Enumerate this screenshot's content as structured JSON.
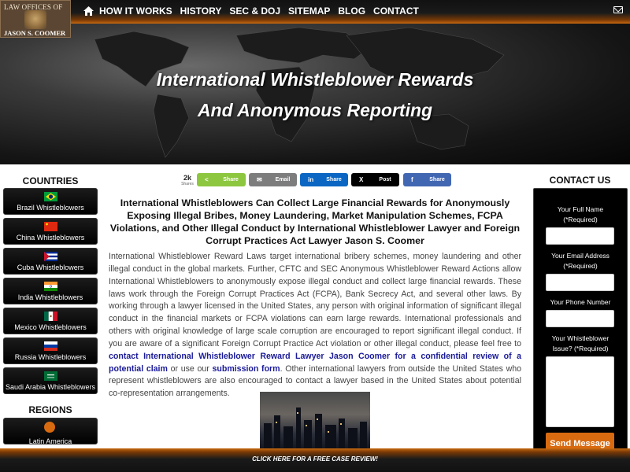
{
  "logo": {
    "line1": "LAW OFFICES OF",
    "line2": "JASON S. COOMER"
  },
  "nav": {
    "items": [
      "HOW IT WORKS",
      "HISTORY",
      "SEC & DOJ",
      "SITEMAP",
      "BLOG",
      "CONTACT"
    ]
  },
  "hero": {
    "line1": "International Whistleblower Rewards",
    "line2": "And Anonymous Reporting"
  },
  "left": {
    "countries_title": "COUNTRIES",
    "countries": [
      "Brazil Whistleblowers",
      "China Whistleblowers",
      "Cuba Whistleblowers",
      "India Whistleblowers",
      "Mexico Whistleblowers",
      "Russia Whistleblowers",
      "Saudi Arabia Whistleblowers"
    ],
    "regions_title": "REGIONS",
    "regions": [
      "Latin America"
    ]
  },
  "share": {
    "count": "2k",
    "count_label": "Shares",
    "buttons": [
      {
        "label": "Share",
        "color": "#8dc63f"
      },
      {
        "label": "Email",
        "color": "#7d7d7d"
      },
      {
        "label": "Share",
        "color": "#0a66c2"
      },
      {
        "label": "Post",
        "color": "#000000"
      },
      {
        "label": "Share",
        "color": "#4267b2"
      }
    ]
  },
  "main": {
    "title": "International Whistleblowers Can Collect Large Financial Rewards for Anonymously Exposing Illegal Bribes, Money Laundering, Market Manipulation Schemes, FCPA Violations, and Other Illegal Conduct by International Whistleblower Lawyer and Foreign Corrupt Practices Act Lawyer Jason S. Coomer",
    "body_1": "International Whistleblower Reward Laws target international bribery schemes, money laundering and other illegal conduct in the global markets. Further, CFTC and SEC Anonymous Whistleblower Reward Actions allow International Whistleblowers to anonymously expose illegal conduct and collect large financial rewards. These laws work through the Foreign Corrupt Practices Act (FCPA), Bank Secrecy Act, and several other laws. By working through a lawyer licensed in the United States, any person with original information of significant illegal conduct in the financial markets or FCPA violations can earn large rewards. International professionals and others with original knowledge of large scale corruption are encouraged to report significant illegal conduct. If you are aware of a significant Foreign Corrupt Practice Act violation or other illegal conduct, please feel free to ",
    "link_1": "contact International Whistleblower Reward Lawyer Jason Coomer for a confidential review of a potential claim",
    "body_2": " or use our ",
    "link_2": "submission form",
    "body_3": ". Other international lawyers from outside the United States who represent whistleblowers are also encouraged to contact a lawyer based in the United States about potential co-representation arrangements."
  },
  "contact": {
    "title": "CONTACT US",
    "name_label": "Your Full Name (*Required)",
    "email_label": "Your Email Address (*Required)",
    "phone_label": "Your Phone Number",
    "issue_label": "Your Whistleblower Issue? (*Required)",
    "submit": "Send Message"
  },
  "cta": {
    "text": "CLICK HERE FOR A FREE CASE REVIEW!"
  },
  "colors": {
    "accent": "#d86a10",
    "dark": "#000000"
  }
}
